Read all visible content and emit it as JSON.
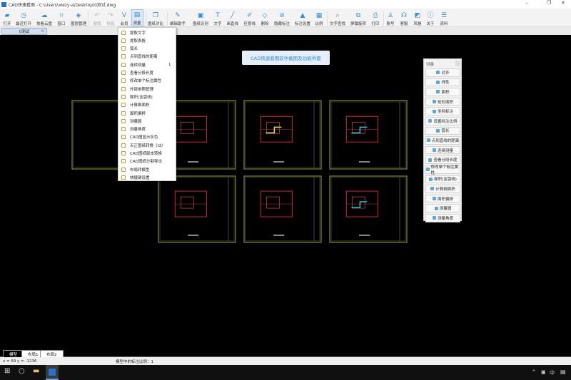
{
  "window": {
    "title": "CAD快速看图 - C:\\Users\\xiezy-a\\Desktop\\0测试.dwg",
    "minimize": "–",
    "restore": "❐",
    "close": "✕"
  },
  "toolbar": [
    {
      "label": "打开",
      "icon": "folder-icon",
      "g": "▰"
    },
    {
      "label": "最近打开",
      "icon": "clock-icon",
      "g": "◷"
    },
    {
      "label": "快看云盘",
      "icon": "cloud-icon",
      "g": "☁"
    },
    {
      "label": "窗口",
      "icon": "window-icon",
      "g": "⌗"
    },
    {
      "label": "图层管理",
      "icon": "layers-icon",
      "g": "◈"
    },
    {
      "label": "撤销",
      "icon": "undo-icon",
      "g": "↶",
      "disabled": true
    },
    {
      "label": "恢复",
      "icon": "redo-icon",
      "g": "↷",
      "disabled": true
    },
    {
      "label": "会员",
      "icon": "vip-icon",
      "g": "V"
    },
    {
      "label": "测量",
      "icon": "ruler-icon",
      "g": "▤",
      "active": true
    },
    {
      "label": "图纸对比",
      "icon": "compare-icon",
      "g": "❐"
    },
    {
      "label": "编辑助手",
      "icon": "edit-assistant-icon",
      "g": "✎"
    },
    {
      "label": "图纸识别",
      "icon": "recognize-icon",
      "g": "▣"
    },
    {
      "label": "文字",
      "icon": "text-icon",
      "g": "T"
    },
    {
      "label": "画直线",
      "icon": "line-icon",
      "g": "╱"
    },
    {
      "label": "任意线",
      "icon": "pencil-icon",
      "g": "✐"
    },
    {
      "label": "删除",
      "icon": "eraser-icon",
      "g": "◇"
    },
    {
      "label": "隐藏标注",
      "icon": "hide-icon",
      "g": "⊘"
    },
    {
      "label": "标注设置",
      "icon": "dim-settings-icon",
      "g": "▲"
    },
    {
      "label": "比例",
      "icon": "scale-icon",
      "g": "▦"
    },
    {
      "label": "文字查找",
      "icon": "text-search-icon",
      "g": "⌕"
    },
    {
      "label": "屏幕旋转",
      "icon": "rotate-icon",
      "g": "⧉"
    },
    {
      "label": "打印",
      "icon": "print-icon",
      "g": "⎙"
    },
    {
      "label": "账号",
      "icon": "user-icon",
      "g": "♙"
    },
    {
      "label": "客服",
      "icon": "headset-icon",
      "g": "☊"
    },
    {
      "label": "风格",
      "icon": "style-icon",
      "g": "◩"
    },
    {
      "label": "关于",
      "icon": "info-icon",
      "g": "ⓘ"
    },
    {
      "label": "资料",
      "icon": "docs-icon",
      "g": "☰"
    }
  ],
  "doc_tab": {
    "label": "0测试",
    "close": "×"
  },
  "banner": "CAD快速看图软件截图及功能界面",
  "measure_menu": [
    {
      "label": "提取文字"
    },
    {
      "label": "提取表格"
    },
    {
      "label": "弧长"
    },
    {
      "label": "点到直线的距离"
    },
    {
      "label": "连续测量",
      "shortcut": "L"
    },
    {
      "label": "查看分段长度"
    },
    {
      "label": "修改单个标注属性"
    },
    {
      "label": "外部参照管理"
    },
    {
      "label": "面积(含弧线)"
    },
    {
      "label": "计算剩面积"
    },
    {
      "label": "面积偏移"
    },
    {
      "label": "测量圆"
    },
    {
      "label": "测量角度"
    },
    {
      "label": "CAD图显示灰色"
    },
    {
      "label": "天正图纸转换（t3）"
    },
    {
      "label": "CAD图纸版本转换"
    },
    {
      "label": "CAD图纸分割导出"
    },
    {
      "label": "布局转模型"
    },
    {
      "label": "快捷键设置"
    }
  ],
  "measure_panel": {
    "title": "测量",
    "items": [
      "对齐",
      "线性",
      "面积",
      "矩形面积",
      "坐标标注",
      "设置标注比例",
      "弧长",
      "点到直线的距离",
      "连续测量",
      "查看分段长度",
      "修改单个标注属性",
      "面积(含弧线)",
      "计算剩面积",
      "面积偏移",
      "测量圆",
      "测量角度"
    ]
  },
  "layout_tabs": [
    "模型",
    "布局1",
    "布局2"
  ],
  "status": {
    "coords": "x = 69  y = -1236",
    "scale": "模型中的标注比例：1"
  },
  "taskbar": {
    "tray_ime": "中"
  },
  "colors": {
    "accent": "#2b8de0",
    "canvas": "#000000",
    "frame": "#c8c864",
    "drawing": "#d02040"
  }
}
